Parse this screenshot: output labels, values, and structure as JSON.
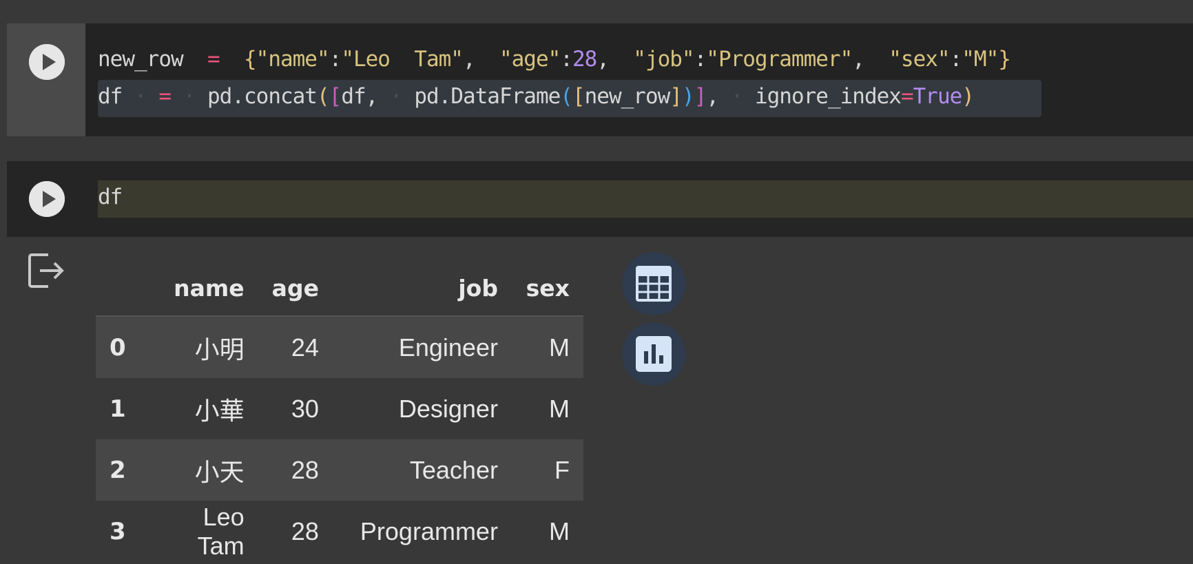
{
  "cell1": {
    "line1_segments": [
      {
        "t": "new_row",
        "c": ""
      },
      {
        "t": "  =  ",
        "c": "k-pink"
      },
      {
        "t": "{",
        "c": "k-yellow"
      },
      {
        "t": "\"name\"",
        "c": "k-str"
      },
      {
        "t": ":",
        "c": ""
      },
      {
        "t": "\"Leo  Tam\"",
        "c": "k-str"
      },
      {
        "t": ",  ",
        "c": ""
      },
      {
        "t": "\"age\"",
        "c": "k-str"
      },
      {
        "t": ":",
        "c": ""
      },
      {
        "t": "28",
        "c": "k-purple"
      },
      {
        "t": ",  ",
        "c": ""
      },
      {
        "t": "\"job\"",
        "c": "k-str"
      },
      {
        "t": ":",
        "c": ""
      },
      {
        "t": "\"Programmer\"",
        "c": "k-str"
      },
      {
        "t": ",  ",
        "c": ""
      },
      {
        "t": "\"sex\"",
        "c": "k-str"
      },
      {
        "t": ":",
        "c": ""
      },
      {
        "t": "\"M\"",
        "c": "k-str"
      },
      {
        "t": "}",
        "c": "k-yellow"
      }
    ],
    "line2_segments": [
      {
        "t": "df",
        "c": ""
      },
      {
        "t": " · ",
        "c": "dot"
      },
      {
        "t": "=",
        "c": "k-pink"
      },
      {
        "t": " · ",
        "c": "dot"
      },
      {
        "t": "pd.concat",
        "c": ""
      },
      {
        "t": "(",
        "c": "k-yellow"
      },
      {
        "t": "[",
        "c": "k-magenta"
      },
      {
        "t": "df,",
        "c": ""
      },
      {
        "t": " · ",
        "c": "dot"
      },
      {
        "t": "pd.DataFrame",
        "c": ""
      },
      {
        "t": "(",
        "c": "k-blue"
      },
      {
        "t": "[",
        "c": "k-yellow"
      },
      {
        "t": "new_row",
        "c": ""
      },
      {
        "t": "]",
        "c": "k-yellow"
      },
      {
        "t": ")",
        "c": "k-blue"
      },
      {
        "t": "]",
        "c": "k-magenta"
      },
      {
        "t": ",",
        "c": ""
      },
      {
        "t": " · ",
        "c": "dot"
      },
      {
        "t": "ignore_index",
        "c": ""
      },
      {
        "t": "=",
        "c": "k-pink"
      },
      {
        "t": "True",
        "c": "k-purple"
      },
      {
        "t": ")",
        "c": "k-yellow"
      }
    ]
  },
  "cell2": {
    "code": "df"
  },
  "table": {
    "columns": [
      "name",
      "age",
      "job",
      "sex"
    ],
    "rows": [
      {
        "index": "0",
        "name": "小明",
        "age": "24",
        "job": "Engineer",
        "sex": "M"
      },
      {
        "index": "1",
        "name": "小華",
        "age": "30",
        "job": "Designer",
        "sex": "M"
      },
      {
        "index": "2",
        "name": "小天",
        "age": "28",
        "job": "Teacher",
        "sex": "F"
      },
      {
        "index": "3",
        "name": "Leo Tam",
        "age": "28",
        "job": "Programmer",
        "sex": "M"
      }
    ]
  },
  "icons": {
    "run": "play-icon",
    "output": "output-arrow-icon",
    "table_view": "calculator-grid-icon",
    "chart_suggest": "bar-chart-icon"
  }
}
